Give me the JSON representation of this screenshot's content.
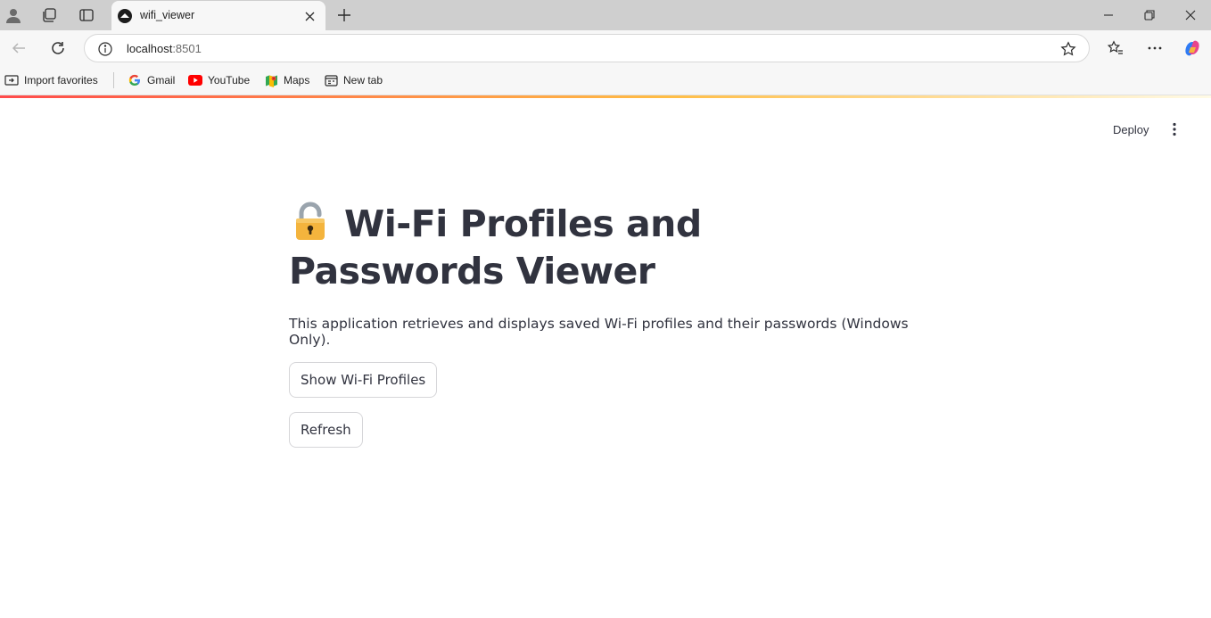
{
  "browser": {
    "tab_title": "wifi_viewer",
    "url_host": "localhost",
    "url_port": ":8501"
  },
  "bookmarks": [
    {
      "label": "Import favorites",
      "icon": "import-icon"
    },
    {
      "label": "Gmail",
      "icon": "google-icon"
    },
    {
      "label": "YouTube",
      "icon": "youtube-icon"
    },
    {
      "label": "Maps",
      "icon": "maps-icon"
    },
    {
      "label": "New tab",
      "icon": "newtab-icon"
    }
  ],
  "header": {
    "deploy_label": "Deploy"
  },
  "main": {
    "title": "Wi-Fi Profiles and Passwords Viewer",
    "title_emoji": "lock-icon",
    "description": "This application retrieves and displays saved Wi-Fi profiles and their passwords (Windows Only).",
    "show_button": "Show Wi-Fi Profiles",
    "refresh_button": "Refresh"
  },
  "colors": {
    "accent_red": "#ff4b4b",
    "text": "#31333f",
    "chrome_bg": "#cfcfcf"
  }
}
